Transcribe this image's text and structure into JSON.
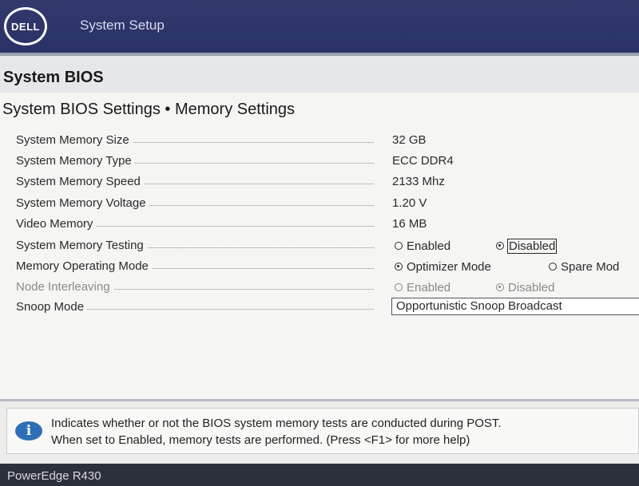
{
  "header": {
    "logo_text": "DELL",
    "title": "System Setup"
  },
  "section": {
    "title": "System BIOS"
  },
  "page": {
    "title": "System BIOS Settings • Memory Settings"
  },
  "settings": [
    {
      "label": "System Memory Size",
      "value": "32 GB"
    },
    {
      "label": "System Memory Type",
      "value": "ECC DDR4"
    },
    {
      "label": "System Memory Speed",
      "value": "2133 Mhz"
    },
    {
      "label": "System Memory Voltage",
      "value": "1.20 V"
    },
    {
      "label": "Video Memory",
      "value": "16 MB"
    },
    {
      "label": "System Memory Testing",
      "options": [
        "Enabled",
        "Disabled"
      ],
      "selected": "Disabled"
    },
    {
      "label": "Memory Operating Mode",
      "options": [
        "Optimizer Mode",
        "Spare Mod"
      ],
      "selected": "Optimizer Mode"
    },
    {
      "label": "Node Interleaving",
      "options": [
        "Enabled",
        "Disabled"
      ],
      "selected": "Disabled",
      "state": "disabled"
    },
    {
      "label": "Snoop Mode",
      "value": "Opportunistic Snoop Broadcast"
    }
  ],
  "help": {
    "line1": "Indicates whether or not the BIOS system memory tests are conducted during POST.",
    "line2": "When set to Enabled, memory tests are performed. (Press <F1> for more help)"
  },
  "footer": {
    "model": "PowerEdge R430"
  },
  "colors": {
    "header_bg": "#2a3166",
    "info_icon": "#2d6fb7",
    "footer_bg": "#2c2f3c"
  }
}
